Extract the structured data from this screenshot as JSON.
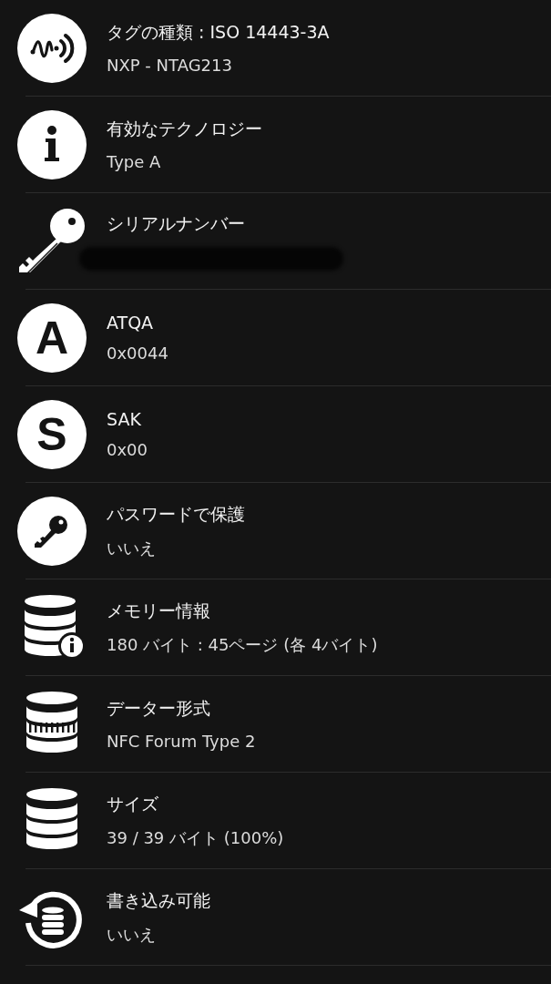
{
  "rows": [
    {
      "kind": "nfc",
      "title": "タグの種類 : ISO 14443-3A",
      "value": "NXP - NTAG213"
    },
    {
      "kind": "info",
      "title": "有効なテクノロジー",
      "value": "Type A"
    },
    {
      "kind": "key",
      "title": "シリアルナンバー",
      "redacted": true
    },
    {
      "kind": "letter",
      "glyph": "A",
      "title": "ATQA",
      "value": "0x0044"
    },
    {
      "kind": "letter",
      "glyph": "S",
      "title": "SAK",
      "value": "0x00"
    },
    {
      "kind": "lock",
      "title": "パスワードで保護",
      "value": "いいえ"
    },
    {
      "kind": "memory",
      "title": "メモリー情報",
      "value": "180 バイト : 45ページ (各 4バイト)"
    },
    {
      "kind": "format",
      "title": "データー形式",
      "value": "NFC Forum Type 2"
    },
    {
      "kind": "size",
      "title": "サイズ",
      "value": "39 / 39 バイト (100%)"
    },
    {
      "kind": "writable",
      "title": "書き込み可能",
      "value": "いいえ"
    }
  ]
}
